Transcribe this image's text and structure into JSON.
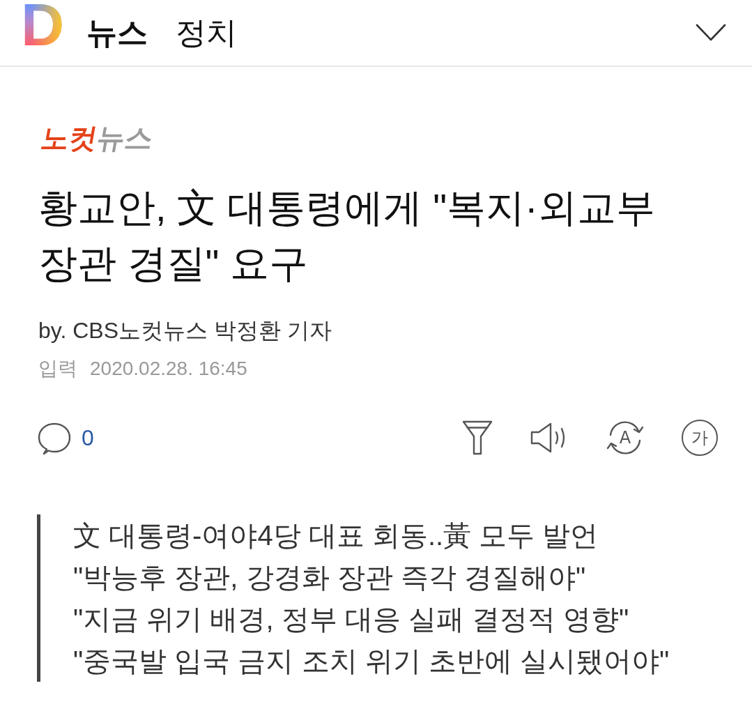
{
  "header": {
    "logo": "D",
    "section": "뉴스",
    "category": "정치"
  },
  "article": {
    "press_logo": [
      "노컷",
      "뉴스"
    ],
    "headline": "황교안, 文 대통령에게 \"복지·외교부 장관 경질\" 요구",
    "byline": "by. CBS노컷뉴스 박정환 기자",
    "date_label": "입력",
    "date": "2020.02.28. 16:45"
  },
  "toolbar": {
    "comment_count": "0",
    "tools": [
      {
        "kind": "filter"
      },
      {
        "kind": "speaker"
      },
      {
        "kind": "translate",
        "label": "A"
      },
      {
        "kind": "font_size",
        "label": "가"
      }
    ]
  },
  "summary": [
    "文 대통령-여야4당 대표 회동..黃 모두 발언",
    "\"박능후 장관, 강경화 장관 즉각 경질해야\"",
    "\"지금 위기 배경, 정부 대응 실패 결정적 영향\"",
    "\"중국발 입국 금지 조치 위기 초반에 실시됐어야\""
  ]
}
